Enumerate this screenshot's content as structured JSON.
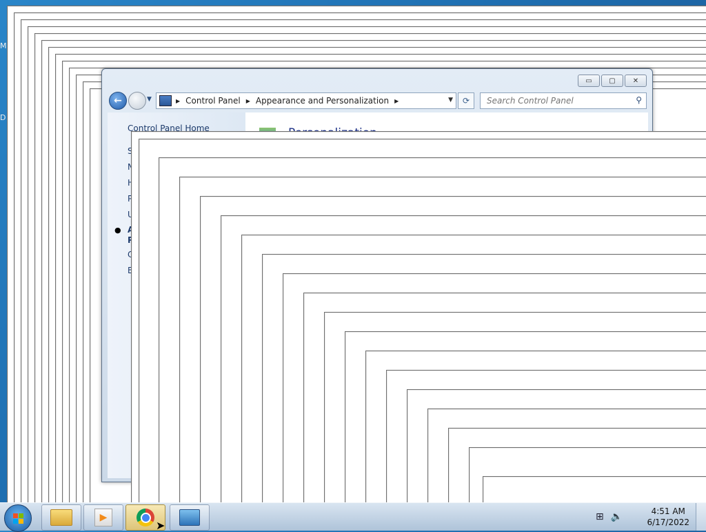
{
  "desktop": {
    "edge_letters": [
      "M",
      "D"
    ]
  },
  "window": {
    "minimize_glyph": "▭",
    "maximize_glyph": "▢",
    "close_glyph": "✕",
    "breadcrumbs": [
      "Control Panel",
      "Appearance and Personalization"
    ],
    "search_placeholder": "Search Control Panel"
  },
  "sidebar": {
    "home_link": "Control Panel Home",
    "partial_items": [
      "S",
      "N",
      "H",
      "P",
      "U",
      "A",
      "P",
      "C",
      "E"
    ]
  },
  "main": {
    "title_partial": "Personalization"
  },
  "taskbar": {
    "clock_time": "4:51 AM",
    "clock_date": "6/17/2022",
    "apps": [
      "windows-explorer",
      "media-player",
      "google-chrome",
      "control-panel"
    ]
  },
  "colors": {
    "accent": "#1f5aa8",
    "title_text": "#1e3287",
    "taskbar_bg": "#c3d3e4"
  }
}
